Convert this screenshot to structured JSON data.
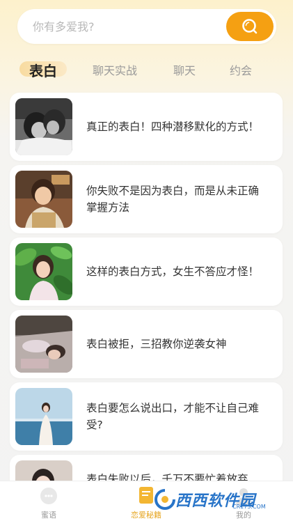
{
  "search": {
    "placeholder": "你有多爱我?"
  },
  "tabs": [
    {
      "label": "表白",
      "active": true
    },
    {
      "label": "聊天实战",
      "active": false
    },
    {
      "label": "聊天",
      "active": false
    },
    {
      "label": "约会",
      "active": false
    }
  ],
  "articles": [
    {
      "title": "真正的表白！四种潜移默化的方式！",
      "thumb": "black-white-couple-photo"
    },
    {
      "title": "你失败不是因为表白，而是从未正确掌握方法",
      "thumb": "smiling-girl-photo"
    },
    {
      "title": "这样的表白方式，女生不答应才怪！",
      "thumb": "girl-with-leaves-photo"
    },
    {
      "title": "表白被拒，三招教你逆袭女神",
      "thumb": "girl-lying-down-photo"
    },
    {
      "title": "表白要怎么说出口，才能不让自己难受?",
      "thumb": "girl-by-sea-photo"
    },
    {
      "title": "表白失败以后，千万不要忙着放弃",
      "thumb": "girl-portrait-photo"
    }
  ],
  "bottom_nav": [
    {
      "label": "蜜语",
      "active": false,
      "icon": "chat-bubble-icon"
    },
    {
      "label": "恋爱秘籍",
      "active": true,
      "icon": "book-icon"
    },
    {
      "label": "我的",
      "active": false,
      "icon": "profile-icon"
    }
  ],
  "watermark": {
    "text": "西西软件园",
    "sub": "CR173.COM"
  },
  "colors": {
    "accent": "#f5a012",
    "tab_highlight": "#f8dba0",
    "nav_active": "#e6a520"
  }
}
